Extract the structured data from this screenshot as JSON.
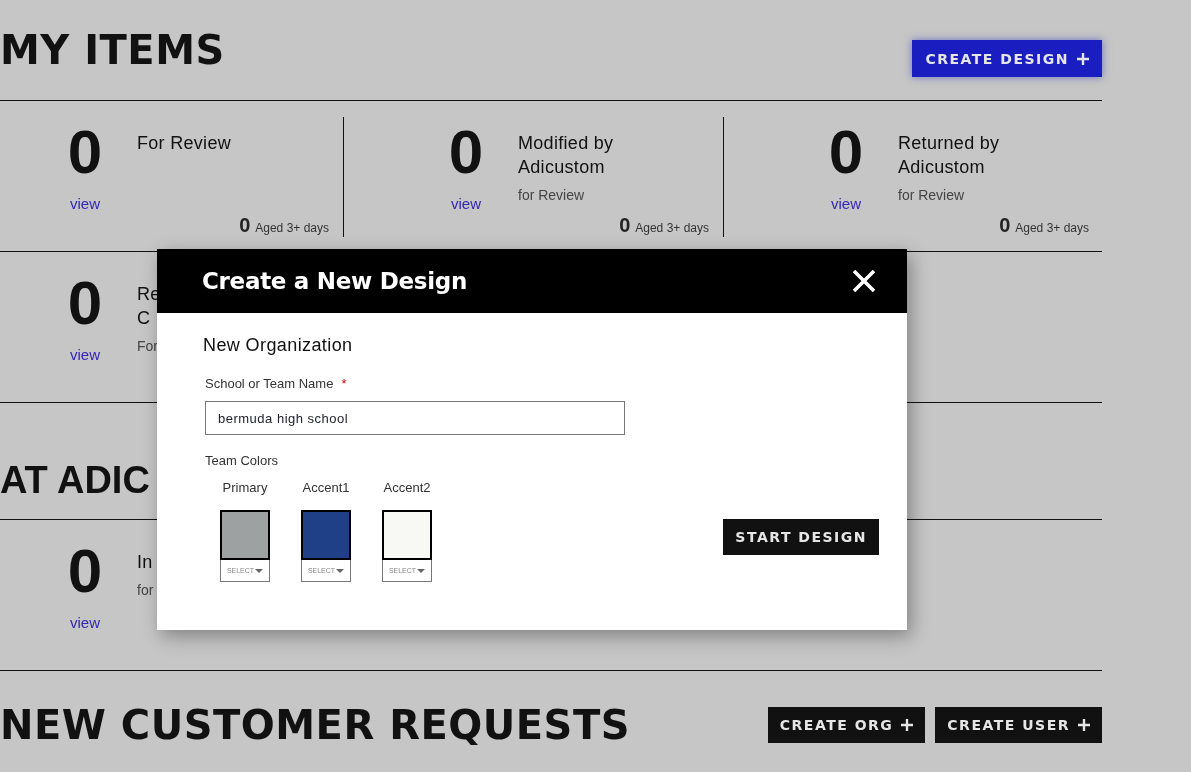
{
  "my_items": {
    "heading": "MY ITEMS",
    "button": "CREATE DESIGN",
    "rows": [
      {
        "stats": [
          {
            "count": "0",
            "link": "view",
            "title_lines": [
              "For Review"
            ],
            "aged_count": "0",
            "aged_label": "Aged 3+ days"
          },
          {
            "count": "0",
            "link": "view",
            "title_lines": [
              "Modified by",
              "Adicustom"
            ],
            "subtitle": "for Review",
            "aged_count": "0",
            "aged_label": "Aged 3+ days"
          },
          {
            "count": "0",
            "link": "view",
            "title_lines": [
              "Returned by",
              "Adicustom"
            ],
            "subtitle": "for Review",
            "aged_count": "0",
            "aged_label": "Aged 3+ days"
          }
        ]
      },
      {
        "stats": [
          {
            "count": "0",
            "link": "view",
            "title_lines": [
              "Re",
              "C"
            ],
            "subtitle": "For"
          }
        ]
      }
    ]
  },
  "at_adicustom": {
    "heading": "AT ADIC",
    "rows": [
      {
        "stats": [
          {
            "count": "0",
            "link": "view",
            "title_lines": [
              "In"
            ],
            "subtitle": "for"
          }
        ]
      }
    ]
  },
  "new_requests": {
    "heading": "NEW CUSTOMER REQUESTS",
    "buttons": [
      "CREATE ORG",
      "CREATE USER"
    ]
  },
  "modal": {
    "title": "Create a New Design",
    "section": "New Organization",
    "field_label": "School or Team Name",
    "required_mark": "*",
    "field_value": "bermuda high school",
    "colors_label": "Team Colors",
    "colors": [
      {
        "label": "Primary",
        "color": "#9ea1a2",
        "select": "SELECT"
      },
      {
        "label": "Accent1",
        "color": "#1f3f87",
        "select": "SELECT"
      },
      {
        "label": "Accent2",
        "color": "#f8f9f5",
        "select": "SELECT"
      }
    ],
    "button": "START DESIGN"
  }
}
